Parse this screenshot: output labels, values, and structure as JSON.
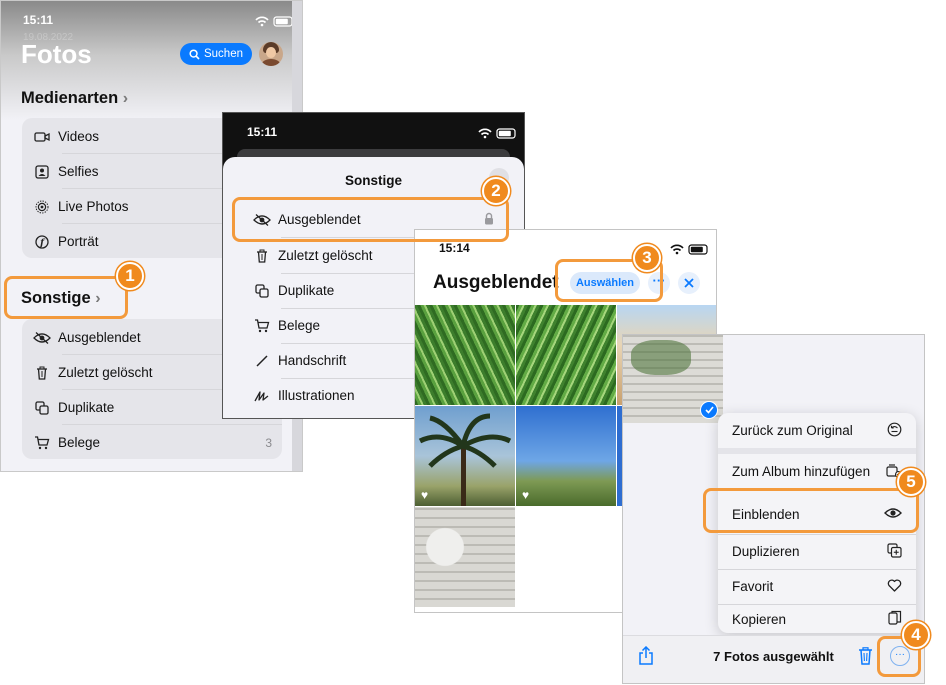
{
  "panel1": {
    "time": "15:11",
    "date_faded": "19.08.2022",
    "title": "Fotos",
    "search_label": "Suchen",
    "section1": "Medienarten",
    "media_items": [
      "Videos",
      "Selfies",
      "Live Photos",
      "Porträt"
    ],
    "section2": "Sonstige",
    "other_items": [
      {
        "label": "Ausgeblendet",
        "count": ""
      },
      {
        "label": "Zuletzt gelöscht",
        "count": ""
      },
      {
        "label": "Duplikate",
        "count": ""
      },
      {
        "label": "Belege",
        "count": "3"
      }
    ]
  },
  "panel2": {
    "time": "15:11",
    "sheet_title": "Sonstige",
    "items": [
      "Ausgeblendet",
      "Zuletzt gelöscht",
      "Duplikate",
      "Belege",
      "Handschrift",
      "Illustrationen"
    ]
  },
  "panel3": {
    "time": "15:14",
    "title": "Ausgeblendet",
    "select_label": "Auswählen"
  },
  "panel4": {
    "menu": [
      "Zurück zum Original",
      "Zum Album hinzufügen",
      "Einblenden",
      "Duplizieren",
      "Favorit",
      "Kopieren"
    ],
    "selected_text": "7 Fotos ausgewählt"
  },
  "badges": [
    "1",
    "2",
    "3",
    "4",
    "5"
  ],
  "colors": {
    "callout": "#f39a3c",
    "badge": "#f08a1e",
    "accent": "#0a7aff"
  }
}
